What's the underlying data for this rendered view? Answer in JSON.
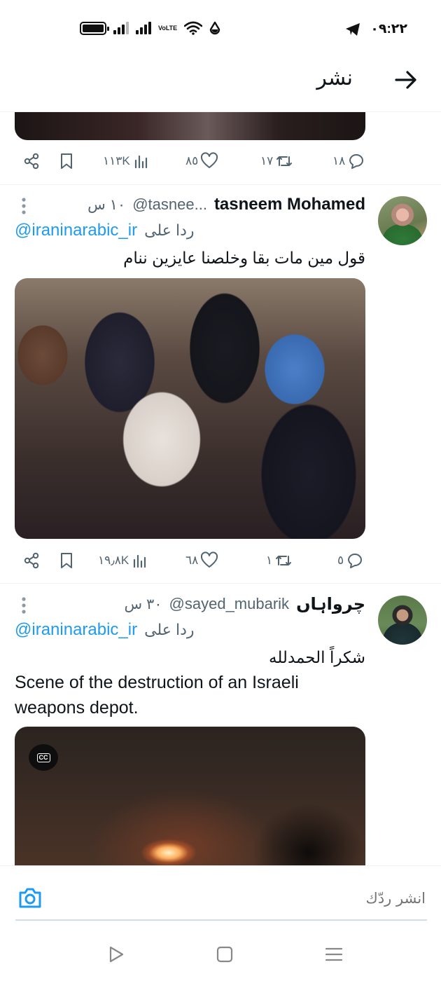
{
  "status_bar": {
    "time": "٠٩:٢٢",
    "network_label": "VoLTE"
  },
  "header": {
    "title": "نشر"
  },
  "tweet_prev": {
    "reply_count": "١٨",
    "retweet_count": "١٧",
    "like_count": "٨٥",
    "view_count": "١١٣K"
  },
  "tweet1": {
    "display_name": "tasneem Mohamed",
    "handle": "@tasnee...",
    "time": "١٠ س",
    "reply_to_label": "ردا على",
    "reply_to_handle": "@iraninarabic_ir",
    "text": "قول مين مات بقا وخلصنا عايزين ننام",
    "reply_count": "٥",
    "retweet_count": "١",
    "like_count": "٦٨",
    "view_count": "١٩٫٨K"
  },
  "tweet2": {
    "display_name": "چرواہاں",
    "handle": "@sayed_mubarik",
    "time": "٣٠ س",
    "reply_to_label": "ردا على",
    "reply_to_handle": "@iraninarabic_ir",
    "text_ar": "شكراً الحمدلله",
    "text_en": "Scene of the destruction of an Israeli weapons depot.",
    "cc_label": "CC"
  },
  "composer": {
    "placeholder": "انشر ردّك"
  },
  "colors": {
    "accent": "#1d9bf0",
    "secondary_text": "#536471",
    "primary_text": "#0f1419"
  }
}
